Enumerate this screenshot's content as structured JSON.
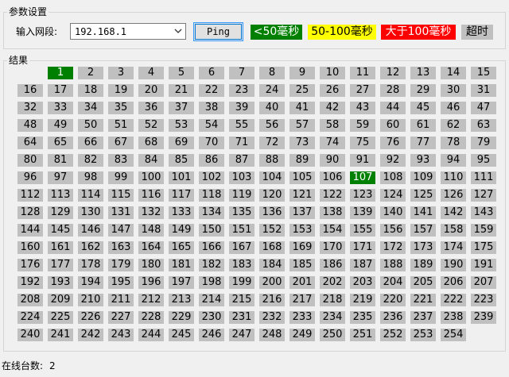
{
  "params": {
    "title": "参数设置",
    "input_label": "输入网段:",
    "ip_value": "192.168.1",
    "ping_label": "Ping"
  },
  "legend": {
    "fast": "<50毫秒",
    "mid": "50-100毫秒",
    "slow": "大于100毫秒",
    "timeout": "超时"
  },
  "colors": {
    "fast": "#008000",
    "mid": "#ffff00",
    "slow": "#ff0000",
    "timeout": "#c0c0c0"
  },
  "results": {
    "title": "结果",
    "host_range": [
      1,
      254
    ],
    "online_hosts": [
      1,
      107
    ]
  },
  "status": {
    "label": "在线台数:",
    "count": "2"
  },
  "icons": {
    "dropdown": "chevron-down-icon"
  }
}
